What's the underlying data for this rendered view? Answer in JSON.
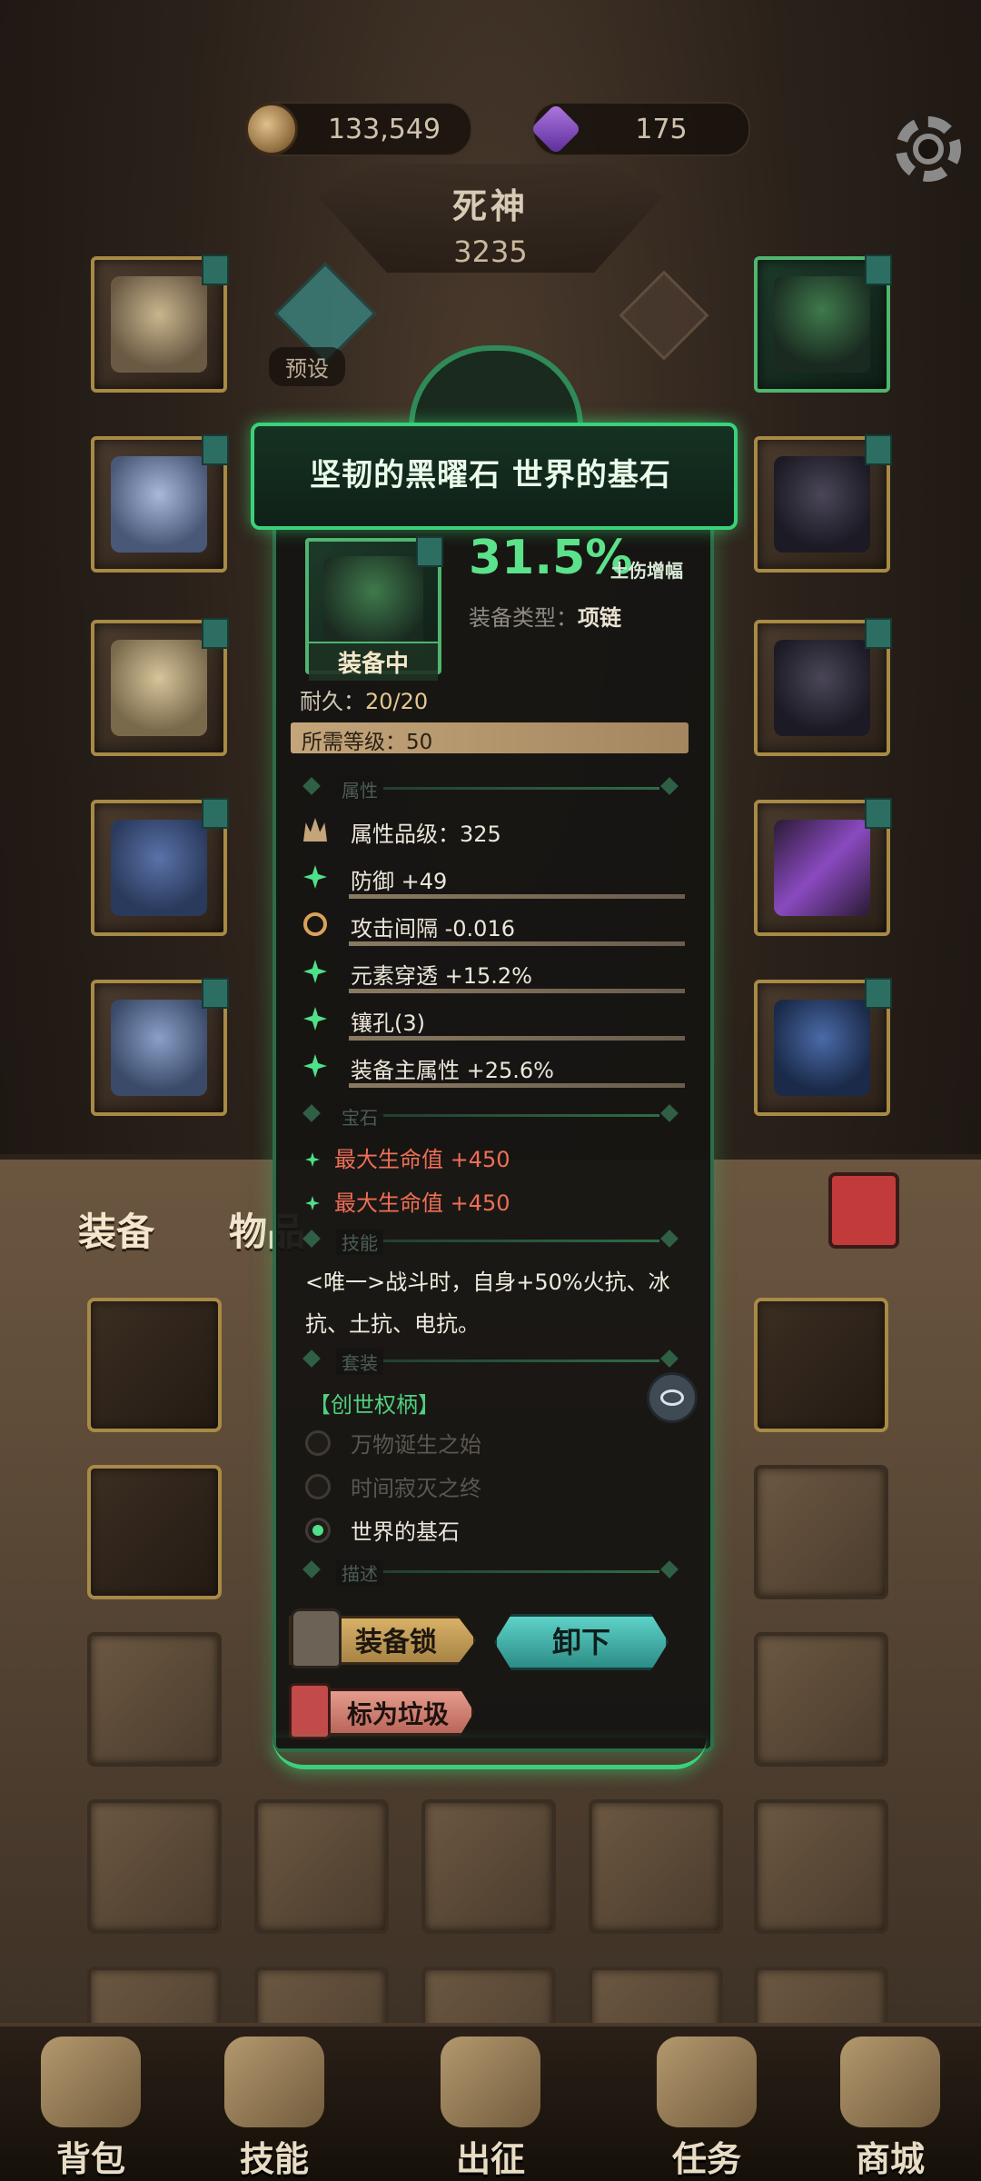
{
  "currency": {
    "gold": "133,549",
    "gems": "175"
  },
  "hero": {
    "name": "死神",
    "power": "3235"
  },
  "preset_label": "预设",
  "tabs": {
    "equipment": "装备",
    "items": "物品"
  },
  "item": {
    "name": "坚韧的黑曜石 世界的基石",
    "equipped_label": "装备中",
    "bonus_value": "31.5%",
    "bonus_label": "土伤增幅",
    "type_label": "装备类型：",
    "type_value": "项链",
    "durability_label": "耐久：",
    "durability_value": "20/20",
    "required_level": "所需等级：50",
    "sections": {
      "attributes": "属性",
      "gems": "宝石",
      "skills": "技能",
      "set": "套装",
      "description": "描述"
    },
    "attributes": [
      {
        "icon": "crown-icon",
        "text": "属性品级：325"
      },
      {
        "icon": "spark-icon",
        "text": "防御 +49"
      },
      {
        "icon": "cycle-icon",
        "text": "攻击间隔 -0.016"
      },
      {
        "icon": "spark-icon",
        "text": "元素穿透 +15.2%"
      },
      {
        "icon": "spark-icon",
        "text": "镶孔(3)"
      },
      {
        "icon": "spark-icon",
        "text": "装备主属性 +25.6%"
      }
    ],
    "gems": [
      "最大生命值 +450",
      "最大生命值 +450"
    ],
    "skill_text": "<唯一>战斗时，自身+50%火抗、冰抗、土抗、电抗。",
    "set_name": "【创世权柄】",
    "set_items": [
      {
        "name": "万物诞生之始",
        "active": false
      },
      {
        "name": "时间寂灭之终",
        "active": false
      },
      {
        "name": "世界的基石",
        "active": true
      }
    ],
    "buttons": {
      "lock": "装备锁",
      "unequip": "卸下",
      "junk": "标为垃圾"
    }
  },
  "nav": [
    "背包",
    "技能",
    "出征",
    "任务",
    "商城"
  ],
  "colors": {
    "rare_green": "#4fe08a",
    "gem_red": "#ef6e56",
    "frame_gold": "#a88a45",
    "unequip_teal": "#5ed2c8"
  }
}
